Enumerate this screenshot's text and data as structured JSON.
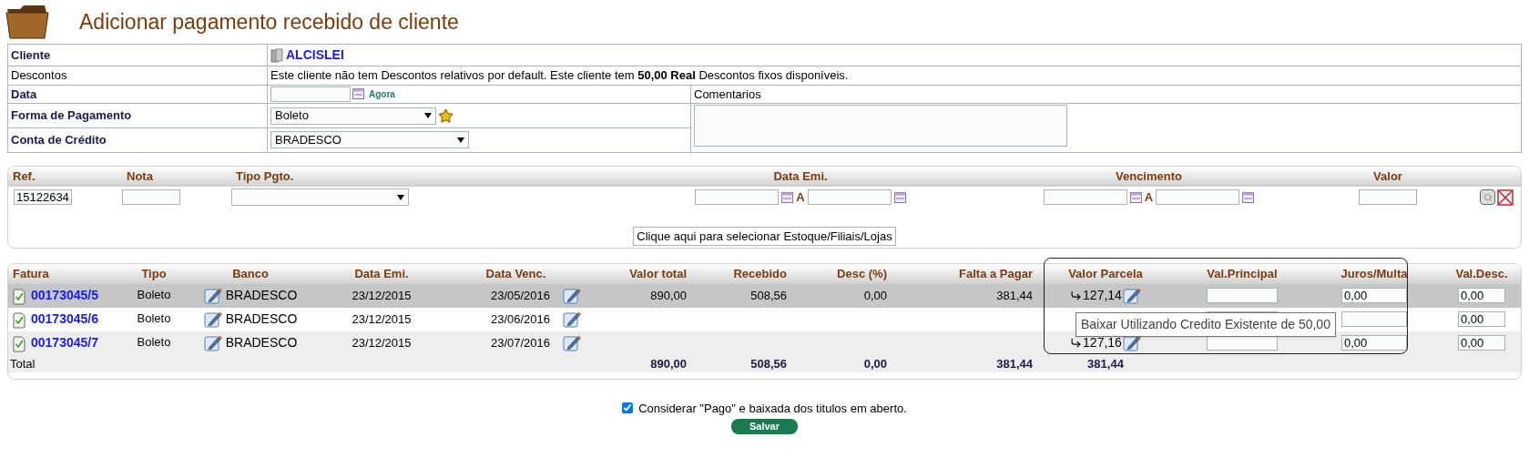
{
  "title": "Adicionar pagamento recebido de cliente",
  "form": {
    "client": {
      "label": "Cliente",
      "name": "ALCISLEI"
    },
    "discounts": {
      "label": "Descontos",
      "text": "Este cliente não tem Descontos relativos por default. Este cliente tem **50,00 Real** Descontos fixos disponíveis."
    },
    "date": {
      "label": "Data",
      "now_link": "Agora"
    },
    "comments": {
      "label": "Comentarios"
    },
    "payment_method": {
      "label": "Forma de Pagamento",
      "value": "Boleto"
    },
    "credit_account": {
      "label": "Conta de Crédito",
      "value": "BRADESCO"
    }
  },
  "filter": {
    "columns": [
      "Ref.",
      "Nota",
      "Tipo Pgto.",
      "Data Emi.",
      "Vencimento",
      "Valor"
    ],
    "ref": "15122634",
    "range_sep_1": "A",
    "range_sep_2": "A",
    "select_button": "Clique aqui para selecionar Estoque/Filiais/Lojas"
  },
  "invoices": {
    "columns": [
      "Fatura",
      "Tipo",
      "Banco",
      "Data Emi.",
      "Data Venc.",
      "Valor total",
      "Recebido",
      "Desc (%)",
      "Falta a Pagar",
      "Valor Parcela",
      "Val.Principal",
      "Juros/Multa",
      "Val.Desc."
    ],
    "rows": [
      {
        "selected": true,
        "fatura": "00173045/5",
        "tipo": "Boleto",
        "banco": "BRADESCO",
        "data_emi": "23/12/2015",
        "data_venc": "23/05/2016",
        "valor_total": "890,00",
        "recebido": "508,56",
        "desc": "0,00",
        "falta": "381,44",
        "parcela": "127,14",
        "juros": "0,00",
        "val_desc": "0,00"
      },
      {
        "selected": false,
        "fatura": "00173045/6",
        "tipo": "Boleto",
        "banco": "BRADESCO",
        "data_emi": "23/12/2015",
        "data_venc": "23/06/2016",
        "val_desc": "0,00"
      },
      {
        "selected": false,
        "fatura": "00173045/7",
        "tipo": "Boleto",
        "banco": "BRADESCO",
        "data_emi": "23/12/2015",
        "data_venc": "23/07/2016",
        "parcela": "127,16",
        "juros": "0,00",
        "val_desc": "0,00"
      }
    ],
    "total": {
      "label": "Total",
      "valor_total": "890,00",
      "recebido": "508,56",
      "desc": "0,00",
      "falta": "381,44",
      "parcela": "381,44"
    }
  },
  "tooltip": "Baixar Utilizando Credito Existente de 50,00",
  "confirm": {
    "checked": true,
    "label": "Considerar \"Pago\" e baixada dos titulos em aberto."
  },
  "save_button": "Salvar"
}
